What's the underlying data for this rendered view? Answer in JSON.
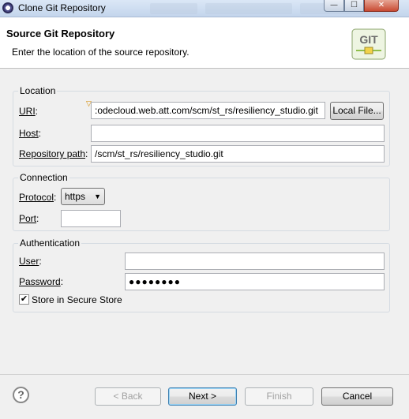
{
  "window": {
    "title": "Clone Git Repository",
    "minimize_glyph": "—",
    "maximize_glyph": "☐",
    "close_glyph": "✕"
  },
  "banner": {
    "heading": "Source Git Repository",
    "description": "Enter the location of the source repository.",
    "logo_text": "GIT"
  },
  "location": {
    "title": "Location",
    "uri_label": "URI",
    "uri_value": ":odecloud.web.att.com/scm/st_rs/resiliency_studio.git",
    "local_file_button": "Local File...",
    "host_label": "Host",
    "host_value": "",
    "repo_path_label": "Repository path",
    "repo_path_value": "/scm/st_rs/resiliency_studio.git"
  },
  "connection": {
    "title": "Connection",
    "protocol_label": "Protocol",
    "protocol_value": "https",
    "port_label": "Port",
    "port_value": ""
  },
  "authentication": {
    "title": "Authentication",
    "user_label": "User",
    "user_value": "",
    "password_label": "Password",
    "password_value": "●●●●●●●●",
    "store_label": "Store in Secure Store",
    "store_checked": true
  },
  "footer": {
    "help_glyph": "?",
    "back_button": "< Back",
    "next_button": "Next >",
    "finish_button": "Finish",
    "cancel_button": "Cancel"
  },
  "colors": {
    "dialog_bg": "#f0f0f0",
    "banner_bg": "#ffffff",
    "default_button_border": "#3c7fb1"
  }
}
